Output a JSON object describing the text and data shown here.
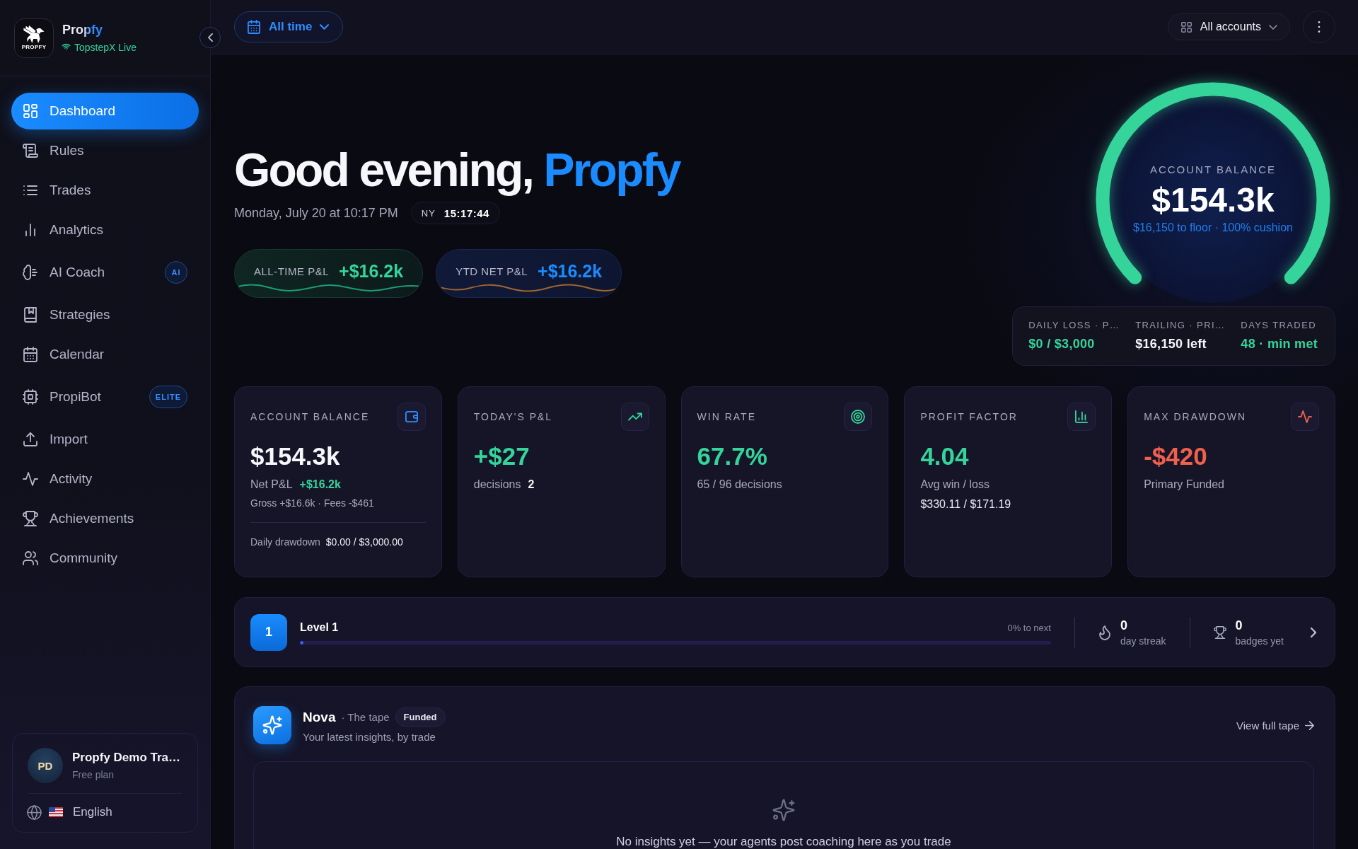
{
  "sidebar": {
    "logo_text": "PROPFY",
    "brand": "Propfy",
    "connection": "TopstepX Live",
    "nav": [
      {
        "label": "Dashboard",
        "selected": true
      },
      {
        "label": "Rules",
        "selected": false
      },
      {
        "label": "Trades",
        "selected": false
      },
      {
        "label": "Analytics",
        "selected": false
      },
      {
        "label": "AI Coach",
        "selected": false,
        "badge": "AI"
      },
      {
        "label": "Strategies",
        "selected": false
      },
      {
        "label": "Calendar",
        "selected": false
      },
      {
        "label": "PropiBot",
        "selected": false,
        "badge": "ELITE"
      },
      {
        "label": "Import",
        "selected": false
      },
      {
        "label": "Activity",
        "selected": false
      },
      {
        "label": "Achievements",
        "selected": false
      },
      {
        "label": "Community",
        "selected": false
      }
    ],
    "user": {
      "initials": "PD",
      "name": "Propfy Demo Tra…",
      "plan": "Free plan"
    },
    "language": "English"
  },
  "topbar": {
    "period": "All time",
    "accounts": "All accounts"
  },
  "hero": {
    "greeting": "Good evening,",
    "name": "Propfy",
    "date": "Monday, July 20 at 10:17 PM",
    "clock": {
      "zone": "NY",
      "time": "15:17:44"
    },
    "pnl": [
      {
        "kind": "alltime",
        "label": "ALL-TIME P&L",
        "value": "+$16.2k"
      },
      {
        "kind": "ytd",
        "label": "YTD NET P&L",
        "value": "+$16.2k"
      }
    ]
  },
  "balance_gauge": {
    "label": "ACCOUNT BALANCE",
    "value": "$154.3k",
    "note": "$16,150 to floor · 100% cushion",
    "level": 1
  },
  "limits": [
    {
      "label": "DAILY LOSS · P…",
      "value": "$0 / $3,000",
      "color": "#35d49a"
    },
    {
      "label": "TRAILING · PRI…",
      "value": "$16,150 left",
      "color": "#f4f4fa"
    },
    {
      "label": "DAYS TRADED",
      "value": "48 · min met",
      "color": "#35d49a"
    }
  ],
  "stat_cards": [
    {
      "label": "ACCOUNT BALANCE",
      "value": "$154.3k",
      "color": "#f6f6fb",
      "details": [
        {
          "kind": "pair",
          "label": "Net P&L",
          "value": "+$16.2k",
          "color": "#35d49a"
        },
        {
          "kind": "note",
          "text": "Gross +$16.6k · Fees -$461"
        }
      ],
      "footer": {
        "label": "Daily drawdown",
        "value": "$0.00 / $3,000.00"
      }
    },
    {
      "label": "TODAY'S P&L",
      "value": "+$27",
      "color": "#35d49a",
      "details": [
        {
          "kind": "pair",
          "label": "decisions",
          "value": "2",
          "color": "#f6f6fb"
        }
      ]
    },
    {
      "label": "WIN RATE",
      "value": "67.7%",
      "color": "#35d49a",
      "details": [
        {
          "kind": "line",
          "text": "65 / 96 decisions"
        }
      ]
    },
    {
      "label": "PROFIT FACTOR",
      "value": "4.04",
      "color": "#35d49a",
      "details": [
        {
          "kind": "line",
          "text": "Avg win / loss"
        },
        {
          "kind": "strong",
          "text": "$330.11 / $171.19"
        }
      ]
    },
    {
      "label": "MAX DRAWDOWN",
      "value": "-$420",
      "color": "#f0604d",
      "details": [
        {
          "kind": "line",
          "text": "Primary Funded"
        }
      ]
    }
  ],
  "level_progress": {
    "number": "1",
    "title": "Level 1",
    "next": "0% to next",
    "level": 0,
    "streak": {
      "value": "0",
      "label": "day streak"
    },
    "badges": {
      "value": "0",
      "label": "badges yet"
    }
  },
  "insights": {
    "agent": "Nova",
    "subtitle": "· The tape",
    "tag": "Funded",
    "description": "Your latest insights, by trade",
    "link": "View full tape",
    "empty_message": "No insights yet — your agents post coaching here as you trade"
  }
}
